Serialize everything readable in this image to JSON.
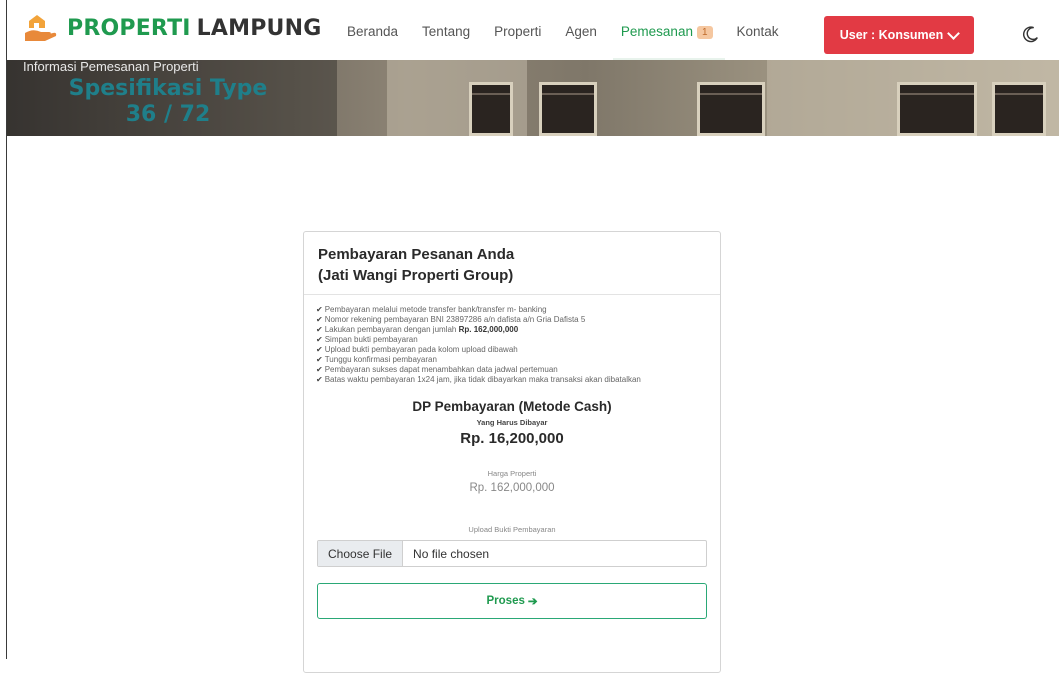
{
  "brand": {
    "name_part1": "PROPERTI",
    "name_part2": "LAMPUNG",
    "logo_icon": "hand-house-icon",
    "colors": {
      "primary": "#1f9a4f",
      "danger": "#e23a44",
      "teal": "#1f7f8a"
    }
  },
  "nav": {
    "items": [
      {
        "label": "Beranda"
      },
      {
        "label": "Tentang"
      },
      {
        "label": "Properti"
      },
      {
        "label": "Agen"
      },
      {
        "label": "Pemesanan",
        "badge": "1",
        "active": true
      },
      {
        "label": "Kontak"
      }
    ],
    "user_button": "User : Konsumen",
    "theme_icon": "moon-icon"
  },
  "hero": {
    "subtitle": "Informasi Pemesanan Properti",
    "title_line1": "Spesifikasi Type",
    "title_line2": "36 / 72"
  },
  "payment": {
    "title_line1": "Pembayaran Pesanan Anda",
    "title_line2": "(Jati Wangi Properti Group)",
    "steps": [
      "Pembayaran melalui metode transfer bank/transfer m- banking",
      "Nomor rekening pembayaran BNI 23897286 a/n dafista a/n Gria Dafista 5",
      "Lakukan pembayaran dengan jumlah ",
      "Simpan bukti pembayaran",
      "Upload bukti pembayaran pada kolom upload dibawah",
      "Tunggu konfirmasi pembayaran",
      "Pembayaran sukses dapat menambahkan data jadwal pertemuan",
      "Batas waktu pembayaran 1x24 jam, jika tidak dibayarkan maka transaksi akan dibatalkan"
    ],
    "steps_amount": "Rp. 162,000,000",
    "dp_title": "DP Pembayaran (Metode Cash)",
    "dp_subtitle": "Yang Harus Dibayar",
    "dp_amount": "Rp. 16,200,000",
    "price_label": "Harga Properti",
    "price_value": "Rp. 162,000,000",
    "upload_label": "Upload Bukti Pembayaran",
    "file_button": "Choose File",
    "file_status": "No file chosen",
    "submit_label": "Proses"
  }
}
